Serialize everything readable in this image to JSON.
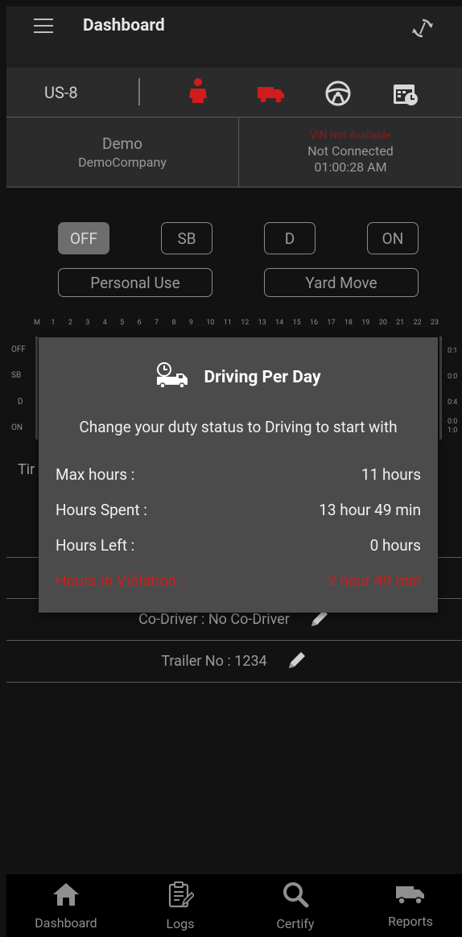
{
  "header": {
    "title": "Dashboard",
    "menu_icon": "hamburger-menu-icon",
    "sync_icon": "sync-icon"
  },
  "status_bar": {
    "ruleset": "US-8",
    "icons": [
      "driver-seat-icon",
      "truck-icon",
      "steering-wheel-icon",
      "calendar-clock-icon"
    ],
    "alert_color": "#d01c1c"
  },
  "driver": {
    "name": "Demo",
    "company": "DemoCompany"
  },
  "eld": {
    "vin": "VIN Not Available",
    "connection": "Not Connected",
    "time": "01:00:28 AM"
  },
  "duty_buttons": {
    "off": "OFF",
    "sb": "SB",
    "d": "D",
    "on": "ON",
    "personal_use": "Personal Use",
    "yard_move": "Yard Move"
  },
  "graph": {
    "hours": [
      "M",
      "1",
      "2",
      "3",
      "4",
      "5",
      "6",
      "7",
      "8",
      "9",
      "10",
      "11",
      "12",
      "13",
      "14",
      "15",
      "16",
      "17",
      "18",
      "19",
      "20",
      "21",
      "22",
      "23"
    ],
    "rows": [
      "OFF",
      "SB",
      "D",
      "ON"
    ],
    "totals": [
      "0:1",
      "0:0",
      "0:4",
      "0:0"
    ],
    "total_extra": "1:0"
  },
  "background_text": {
    "timer_partial": "Tir"
  },
  "info_rows": {
    "co_driver": "Co-Driver : No Co-Driver",
    "trailer": "Trailer No : 1234"
  },
  "modal": {
    "title": "Driving Per Day",
    "subtitle": "Change your duty status to Driving to start with",
    "rows": [
      {
        "label": "Max hours :",
        "value": "11 hours"
      },
      {
        "label": "Hours Spent :",
        "value": "13 hour 49 min"
      },
      {
        "label": "Hours Left :",
        "value": "0 hours"
      },
      {
        "label": "Hours in Violation :",
        "value": "2 hour 49 min"
      }
    ],
    "violation_color": "#cc1e1e"
  },
  "nav": [
    {
      "label": "Dashboard",
      "icon": "home-icon"
    },
    {
      "label": "Logs",
      "icon": "clipboard-icon"
    },
    {
      "label": "Certify",
      "icon": "search-icon"
    },
    {
      "label": "Reports",
      "icon": "truck-icon"
    }
  ]
}
